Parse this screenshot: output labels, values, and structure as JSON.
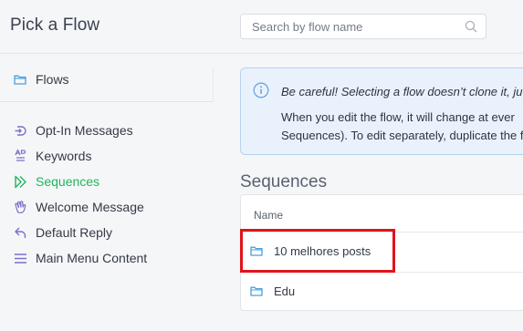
{
  "header": {
    "title": "Pick a Flow",
    "search_placeholder": "Search by flow name",
    "search_value": ""
  },
  "sidebar": {
    "top_item": {
      "label": "Flows",
      "icon": "folder-icon"
    },
    "items": [
      {
        "label": "Opt-In Messages",
        "icon": "opt-in-icon",
        "active": false
      },
      {
        "label": "Keywords",
        "icon": "keywords-icon",
        "active": false
      },
      {
        "label": "Sequences",
        "icon": "sequences-icon",
        "active": true
      },
      {
        "label": "Welcome Message",
        "icon": "wave-hand-icon",
        "active": false
      },
      {
        "label": "Default Reply",
        "icon": "reply-icon",
        "active": false
      },
      {
        "label": "Main Menu Content",
        "icon": "menu-lines-icon",
        "active": false
      }
    ]
  },
  "alert": {
    "icon": "info-icon",
    "line1": "Be careful! Selecting a flow doesn’t clone it, ju",
    "line2": "When you edit the flow, it will change at ever",
    "line3": "Sequences). To edit separately, duplicate the f"
  },
  "main": {
    "section_title": "Sequences",
    "table": {
      "column_header": "Name",
      "rows": [
        {
          "label": "10 melhores posts",
          "icon": "folder-icon"
        },
        {
          "label": "Edu",
          "icon": "folder-icon"
        }
      ]
    }
  },
  "colors": {
    "accent_active": "#22b45e",
    "icon_purple": "#7b6fc9",
    "folder_blue": "#4a9fdf",
    "alert_bg": "#e9f2fc",
    "alert_border": "#b6d1ef",
    "highlight": "#e0141b"
  }
}
